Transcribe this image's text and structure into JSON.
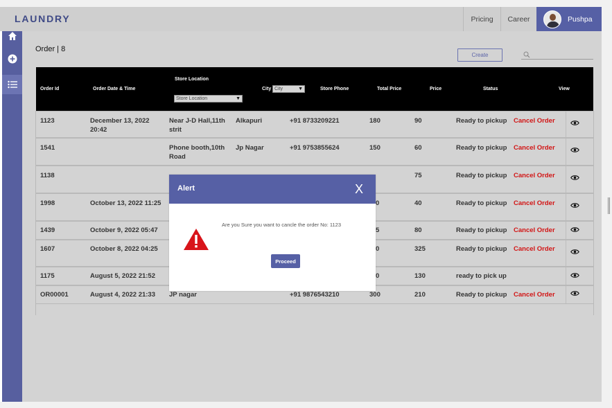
{
  "header": {
    "brand": "LAUNDRY",
    "nav": [
      "Pricing",
      "Career"
    ],
    "user": "Pushpa"
  },
  "page": {
    "title": "Order | 8",
    "create_label": "Create"
  },
  "table": {
    "headers": {
      "order_id": "Order Id",
      "order_date": "Order Date & Time",
      "store_location": "Store Location",
      "city": "City",
      "store_phone": "Store Phone",
      "total_price": "Total Price",
      "price": "Price",
      "status": "Status",
      "view": "View"
    },
    "filters": {
      "store_location": "Store Location",
      "city": "City"
    },
    "rows": [
      {
        "id": "1123",
        "date": "December 13, 2022 20:42",
        "location": "Near J-D Hall,11th strit",
        "city": "Alkapuri",
        "phone": "+91 8733209221",
        "total": "180",
        "price": "90",
        "status": "Ready to pickup",
        "action": "Cancel Order"
      },
      {
        "id": "1541",
        "date": "",
        "location": "Phone booth,10th Road",
        "city": "Jp Nagar",
        "phone": "+91 9753855624",
        "total": "150",
        "price": "60",
        "status": "Ready to pickup",
        "action": "Cancel Order"
      },
      {
        "id": "1138",
        "date": "",
        "location": "",
        "city": "",
        "phone": "",
        "total": "",
        "price": "75",
        "status": "Ready to pickup",
        "action": "Cancel Order"
      },
      {
        "id": "1998",
        "date": "October 13, 2022 11:25",
        "location": "",
        "city": "",
        "phone": "",
        "total": "",
        "price": "40",
        "status": "Ready to pickup",
        "action": "Cancel Order"
      },
      {
        "id": "1439",
        "date": "October 9, 2022 05:47",
        "location": "",
        "city": "",
        "phone": "",
        "total": "",
        "price": "80",
        "status": "Ready to pickup",
        "action": "Cancel Order"
      },
      {
        "id": "1607",
        "date": "October 8, 2022 04:25",
        "location": "",
        "city": "",
        "phone": "",
        "total": "",
        "price": "325",
        "status": "Ready to pickup",
        "action": "Cancel Order"
      },
      {
        "id": "1175",
        "date": "August 5, 2022 21:52",
        "location": "",
        "city": "",
        "phone": "",
        "total": "",
        "price": "130",
        "status": "ready to pick up",
        "action": ""
      },
      {
        "id": "OR00001",
        "date": "August 4, 2022 21:33",
        "location": "JP nagar",
        "city": "",
        "phone": "+91 9876543210",
        "total": "300",
        "price": "210",
        "status": "Ready to pickup",
        "action": "Cancel Order"
      }
    ],
    "partial_totals": [
      "0",
      "5",
      "0",
      "0"
    ]
  },
  "dialog": {
    "title": "Alert",
    "close": "X",
    "message": "Are you Sure you want to cancle the order No: 1123",
    "button": "Proceed"
  },
  "colors": {
    "accent": "#5660a5",
    "cancel": "#d21414",
    "header_bg": "#000000",
    "panel_bg": "#d3d3d3"
  },
  "icons": [
    "home-icon",
    "plus-circle-icon",
    "list-icon",
    "search-icon",
    "eye-icon",
    "warning-icon",
    "chevron-down-icon"
  ]
}
